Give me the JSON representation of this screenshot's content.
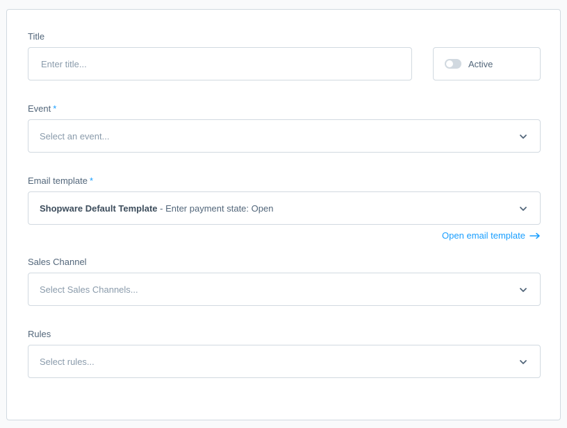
{
  "form": {
    "title_label": "Title",
    "title_placeholder": "Enter title...",
    "title_value": "",
    "active_label": "Active",
    "active_on": false,
    "event_label": "Event",
    "event_required_mark": "*",
    "event_placeholder": "Select an event...",
    "email_template_label": "Email template",
    "email_template_required_mark": "*",
    "email_template_value_bold": "Shopware Default Template",
    "email_template_value_rest": " - Enter payment state: Open",
    "open_template_link": "Open email template",
    "sales_channel_label": "Sales Channel",
    "sales_channel_placeholder": "Select Sales Channels...",
    "rules_label": "Rules",
    "rules_placeholder": "Select rules..."
  },
  "icons": {
    "select_chevron": "chevron-down-icon",
    "link_arrow": "arrow-right-icon"
  },
  "colors": {
    "accent": "#189eff",
    "border": "#d1d9e0",
    "text": "#52667a",
    "placeholder": "#8a9bab"
  }
}
